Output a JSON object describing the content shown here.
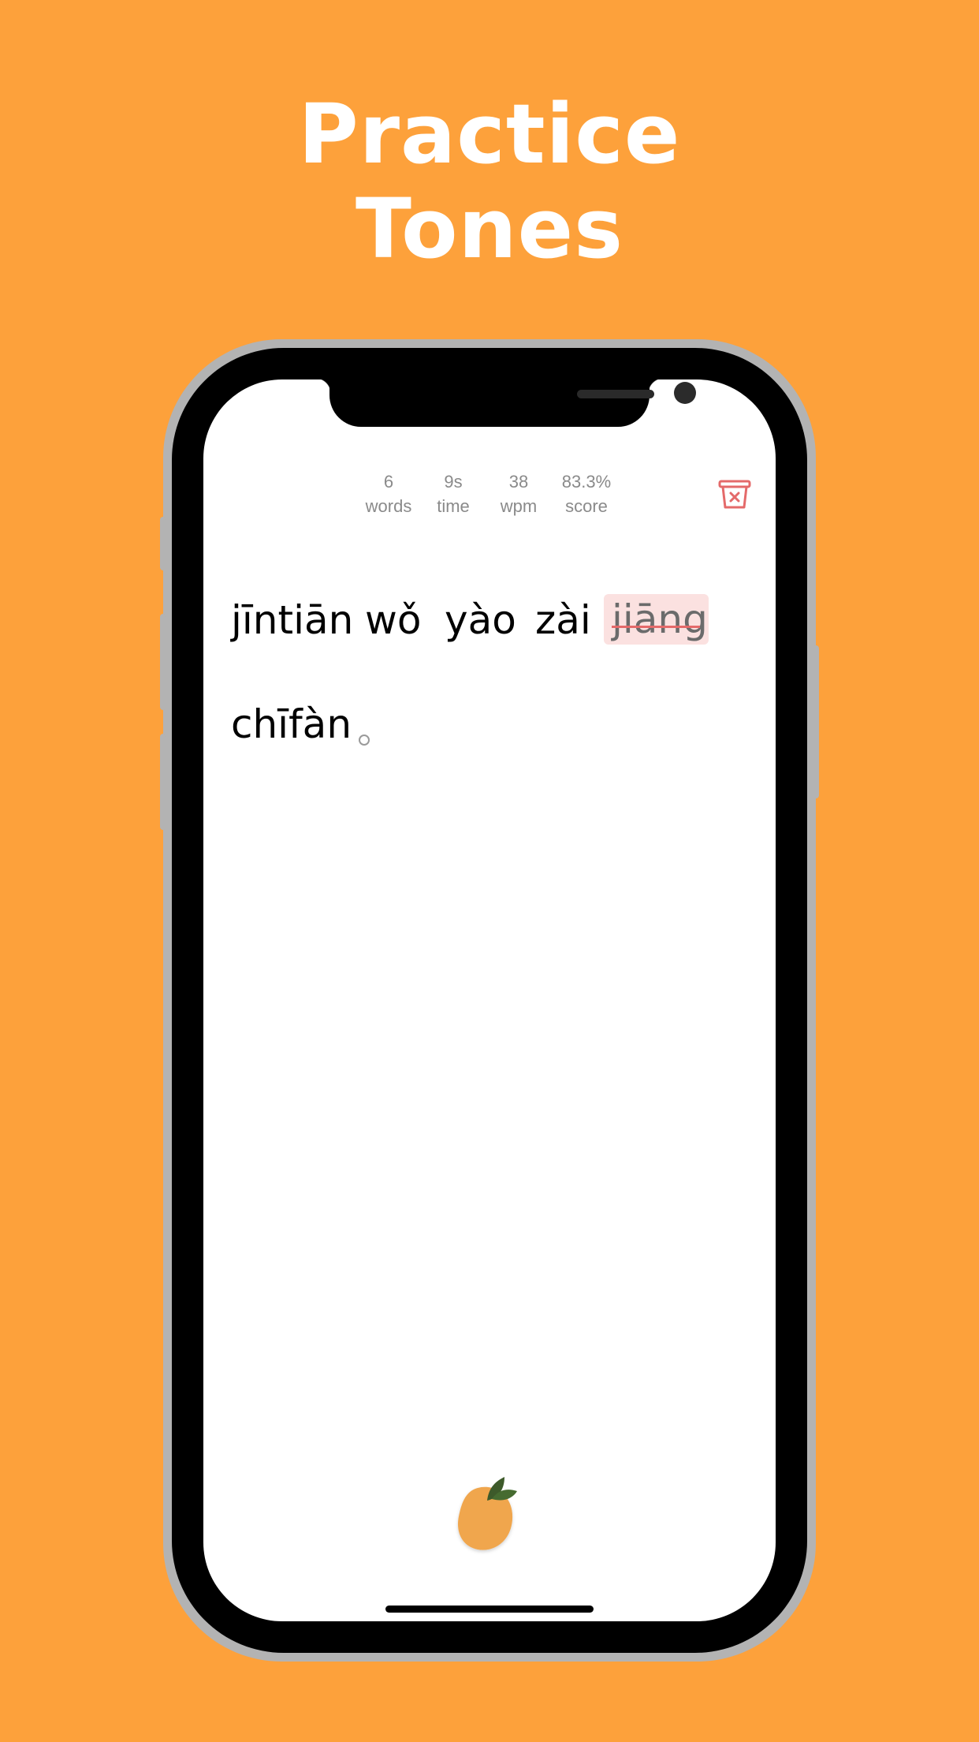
{
  "headline": {
    "line1": "Practice",
    "line2": "Tones"
  },
  "stats": [
    {
      "value": "6",
      "label": "words"
    },
    {
      "value": "9s",
      "label": "time"
    },
    {
      "value": "38",
      "label": "wpm"
    },
    {
      "value": "83.3%",
      "label": "score"
    }
  ],
  "passage": {
    "line1": [
      "jīntiān",
      "wǒ",
      "yào",
      "zài"
    ],
    "wrong_word": "jiāng",
    "line2": [
      "chīfàn"
    ]
  },
  "icons": {
    "reset": "trash-x-icon",
    "logo": "orange-fruit-icon"
  },
  "colors": {
    "background": "#fda13b",
    "error_highlight": "#fbe1e0",
    "error_strike": "#e46a6a",
    "stat_text": "#8a8a8a"
  }
}
